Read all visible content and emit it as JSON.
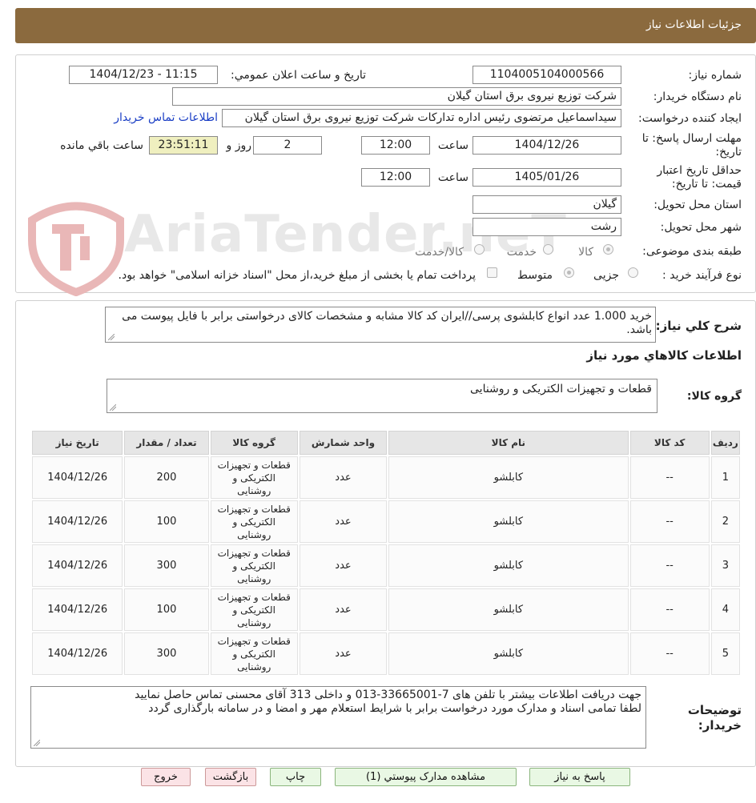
{
  "header": {
    "title": "جزئیات اطلاعات نیاز"
  },
  "form": {
    "need_number_label": "شماره نیاز:",
    "need_number": "1104005104000566",
    "announce_label": "تاریخ و ساعت اعلان عمومي:",
    "announce_value": "1404/12/23 - 11:15",
    "buyer_org_label": "نام دستگاه خريدار:",
    "buyer_org": "شرکت توزیع نیروی برق استان گیلان",
    "requester_label": "ايجاد کننده درخواست:",
    "requester": "سیداسماعیل مرتضوی رئیس اداره تدارکات شرکت توزیع نیروی برق استان گیلان",
    "buyer_contact_link": "اطلاعات تماس خريدار",
    "reply_deadline_label": "مهلت ارسال پاسخ: تا تاریخ:",
    "reply_date": "1404/12/26",
    "time_label": "ساعت",
    "reply_time": "12:00",
    "days_value": "2",
    "days_label": "روز و",
    "countdown": "23:51:11",
    "remaining_label": "ساعت باقي مانده",
    "validity_label": "حداقل تاريخ اعتبار قيمت: تا تاريخ:",
    "validity_date": "1405/01/26",
    "validity_time": "12:00",
    "province_label": "استان محل تحويل:",
    "province": "گیلان",
    "city_label": "شهر محل تحويل:",
    "city": "رشت",
    "category_label": "طبقه بندی موضوعی:",
    "category_options": [
      "کالا",
      "خدمت",
      "کالا/خدمت"
    ],
    "category_selected": "کالا",
    "process_label": "نوع فرآيند خريد :",
    "process_options": [
      "جزیی",
      "متوسط"
    ],
    "process_selected": "متوسط",
    "payment_note": "پرداخت تمام یا بخشی از مبلغ خرید،از محل \"اسناد خزانه اسلامی\" خواهد بود."
  },
  "watermark": {
    "text": "AriaTender.neT"
  },
  "summary": {
    "label": "شرح کلي نياز:",
    "text": "خرید 1.000 عدد انواع کابلشوی پرسی//ایران کد کالا مشابه و مشخصات کالای درخواستی برابر با فایل پیوست می باشد."
  },
  "goods": {
    "section_title": "اطلاعات کالاهاي مورد نياز",
    "group_label": "گروه کالا:",
    "group_value": "قطعات و تجهیزات الکتریکی و روشنایی"
  },
  "table": {
    "headers": [
      "رديف",
      "کد کالا",
      "نام کالا",
      "واحد شمارش",
      "گروه کالا",
      "تعداد / مقدار",
      "تاريخ نياز"
    ],
    "rows": [
      [
        "1",
        "--",
        "کابلشو",
        "عدد",
        "قطعات و تجهیزات الکتریکی و روشنایی",
        "200",
        "1404/12/26"
      ],
      [
        "2",
        "--",
        "کابلشو",
        "عدد",
        "قطعات و تجهیزات الکتریکی و روشنایی",
        "100",
        "1404/12/26"
      ],
      [
        "3",
        "--",
        "کابلشو",
        "عدد",
        "قطعات و تجهیزات الکتریکی و روشنایی",
        "300",
        "1404/12/26"
      ],
      [
        "4",
        "--",
        "کابلشو",
        "عدد",
        "قطعات و تجهیزات الکتریکی و روشنایی",
        "100",
        "1404/12/26"
      ],
      [
        "5",
        "--",
        "کابلشو",
        "عدد",
        "قطعات و تجهیزات الکتریکی و روشنایی",
        "300",
        "1404/12/26"
      ]
    ]
  },
  "buyer_notes": {
    "label": "توضيحات خريدار:",
    "line1": "جهت دریافت اطلاعات بیشتر با تلفن های 7-33665001-013 و داخلی 313 آقای محسنی تماس حاصل نمایید",
    "line2": "لطفا تمامی اسناد و مدارک مورد درخواست برابر با شرایط استعلام مهر و امضا و در سامانه بارگذاری گردد"
  },
  "buttons": {
    "reply": "پاسخ به نياز",
    "attachments": "مشاهده مدارک پيوستي (1)",
    "print": "چاپ",
    "back": "بازگشت",
    "exit": "خروج"
  }
}
